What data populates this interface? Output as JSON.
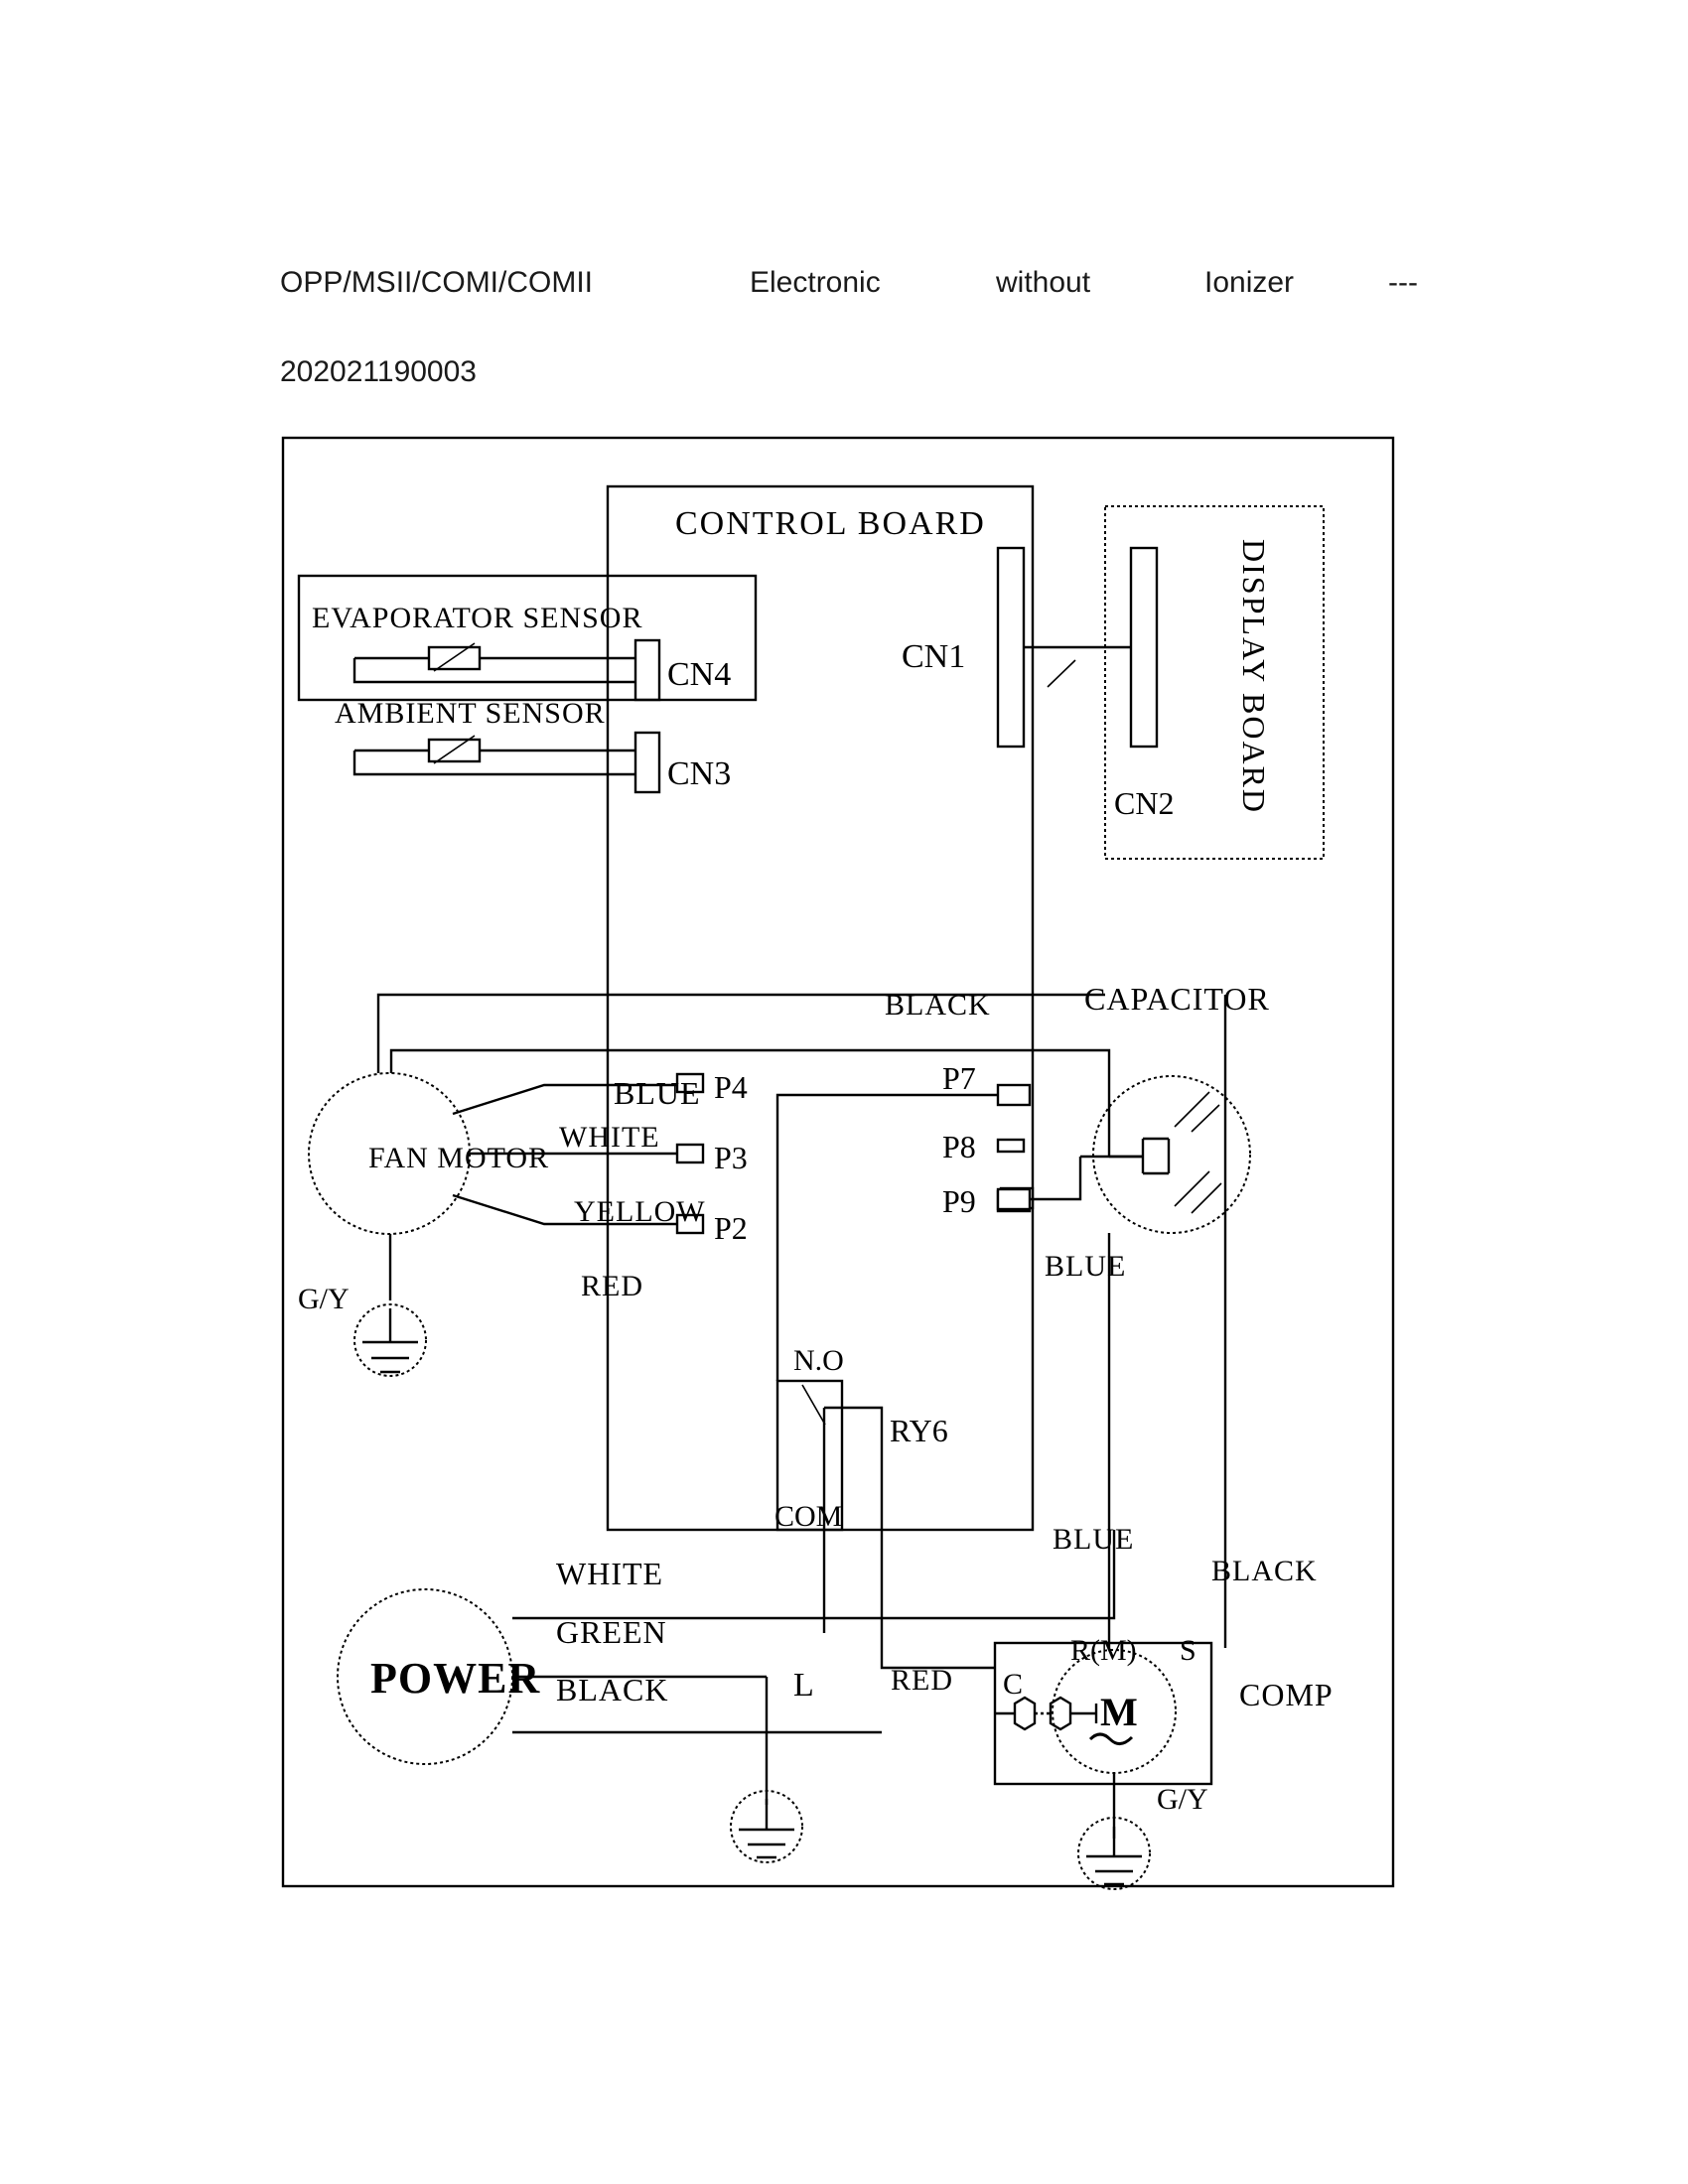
{
  "header": {
    "line1_model": "OPP/MSII/COMI/COMII",
    "line1_type": "Electronic",
    "line1_qualifier": "without",
    "line1_feature": "Ionizer",
    "line1_dash": "---",
    "line2_code": "202021190003"
  },
  "diagram": {
    "title_control_board": "CONTROL BOARD",
    "title_display_board": "DISPLAY BOARD",
    "title_capacitor": "CAPACITOR",
    "label_comp": "COMP",
    "label_power": "POWER",
    "label_fan_motor": "FAN MOTOR",
    "label_relay": "RY6"
  },
  "connectors": {
    "cn1": "CN1",
    "cn2": "CN2",
    "cn3": "CN3",
    "cn4": "CN4"
  },
  "sensors": {
    "evaporator": "EVAPORATOR SENSOR",
    "ambient": "AMBIENT SENSOR"
  },
  "terminals": {
    "p2": "P2",
    "p3": "P3",
    "p4": "P4",
    "p7": "P7",
    "p8": "P8",
    "p9": "P9"
  },
  "relay": {
    "no": "N.O",
    "com": "COM"
  },
  "compressor": {
    "c": "C",
    "r": "R(M)",
    "s": "S",
    "motor": "M"
  },
  "wire_colors": {
    "fan_blue": "BLUE",
    "fan_white": "WHITE",
    "fan_yellow": "YELLOW",
    "fan_red": "RED",
    "cap_black": "BLACK",
    "cap_blue": "BLUE",
    "comp_blue": "BLUE",
    "comp_black": "BLACK",
    "comp_red": "RED",
    "power_white": "WHITE",
    "power_green": "GREEN",
    "power_black": "BLACK"
  },
  "ground_labels": {
    "fan_gy": "G/Y",
    "comp_gy": "G/Y"
  },
  "line_labels": {
    "live": "L"
  },
  "colors": {
    "stroke": "#000000",
    "background": "#ffffff"
  }
}
